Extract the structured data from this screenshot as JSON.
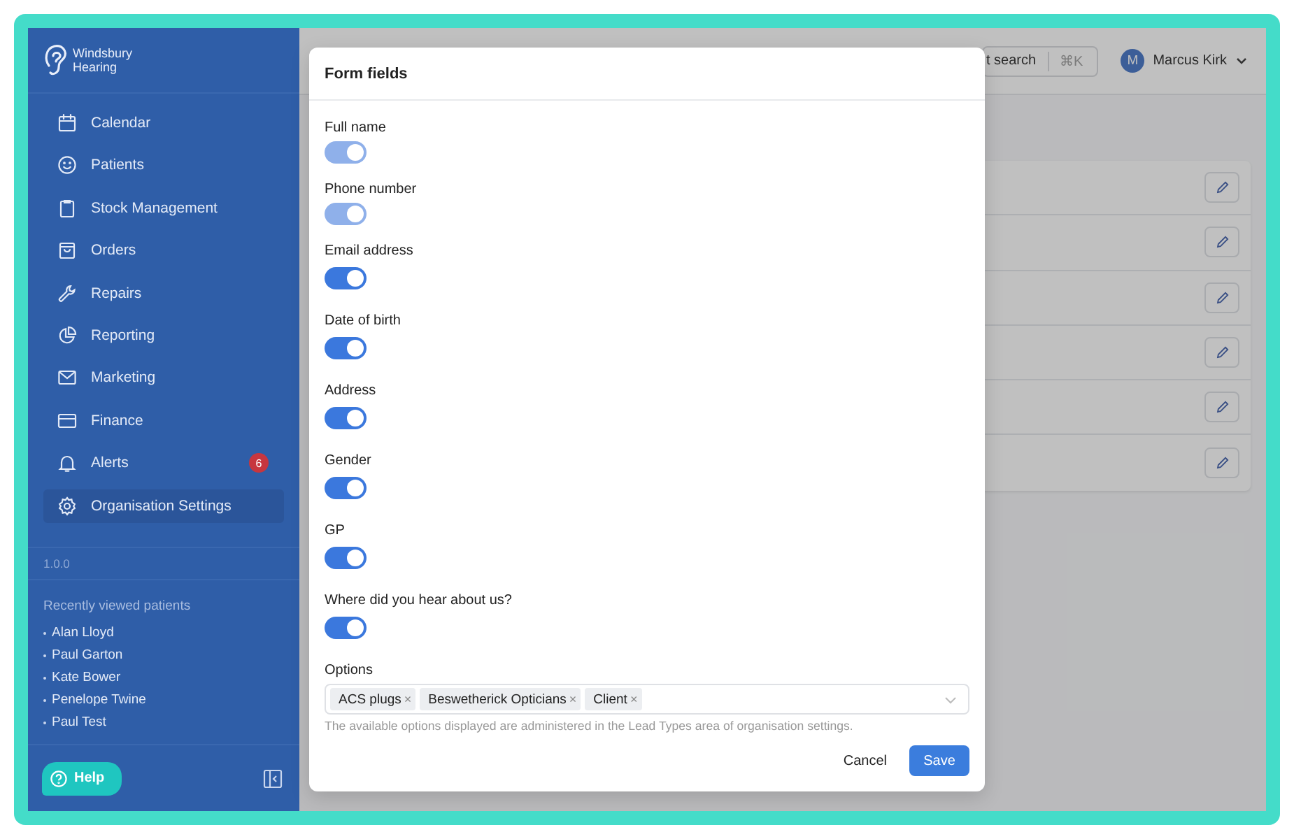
{
  "sidebar": {
    "brand": "Windsbury Hearing",
    "nav": [
      {
        "label": "Calendar",
        "selected": false
      },
      {
        "label": "Patients",
        "selected": false
      },
      {
        "label": "Stock Management",
        "selected": false
      },
      {
        "label": "Orders",
        "selected": false
      },
      {
        "label": "Repairs",
        "selected": false
      },
      {
        "label": "Reporting",
        "selected": false
      },
      {
        "label": "Marketing",
        "selected": false
      },
      {
        "label": "Finance",
        "selected": false
      },
      {
        "label": "Alerts",
        "selected": false,
        "badge": "6"
      },
      {
        "label": "Organisation Settings",
        "selected": true
      }
    ],
    "version": "1.0.0",
    "recent_title": "Recently viewed patients",
    "recent": [
      "Alan Lloyd",
      "Paul Garton",
      "Kate Bower",
      "Penelope Twine",
      "Paul Test"
    ],
    "help": "Help"
  },
  "header": {
    "search": "t search",
    "shortcut": "⌘K",
    "user": {
      "initial": "M",
      "name": "Marcus Kirk"
    }
  },
  "table": {
    "rows": [
      {
        "kind": "edit"
      },
      {
        "kind": "edit"
      },
      {
        "kind": "edit"
      },
      {
        "kind": "edit"
      },
      {
        "kind": "edit"
      },
      {
        "kind": "edit"
      }
    ]
  },
  "modal": {
    "title": "Form fields",
    "fields": [
      {
        "label": "Full name",
        "on": true,
        "disabled": true
      },
      {
        "label": "Phone number",
        "on": true,
        "disabled": true
      },
      {
        "label": "Email address",
        "on": true,
        "disabled": false
      },
      {
        "label": "Date of birth",
        "on": true,
        "disabled": false
      },
      {
        "label": "Address",
        "on": true,
        "disabled": false
      },
      {
        "label": "Gender",
        "on": true,
        "disabled": false
      },
      {
        "label": "GP",
        "on": true,
        "disabled": false
      },
      {
        "label": "Where did you hear about us?",
        "on": true,
        "disabled": false
      }
    ],
    "options_label": "Options",
    "options": [
      "ACS plugs",
      "Beswetherick Opticians",
      "Client"
    ],
    "remove_mark": "×",
    "help_text": "The available options displayed are administered in the Lead Types area of organisation settings.",
    "buttons": {
      "cancel": "Cancel",
      "save": "Save"
    }
  }
}
